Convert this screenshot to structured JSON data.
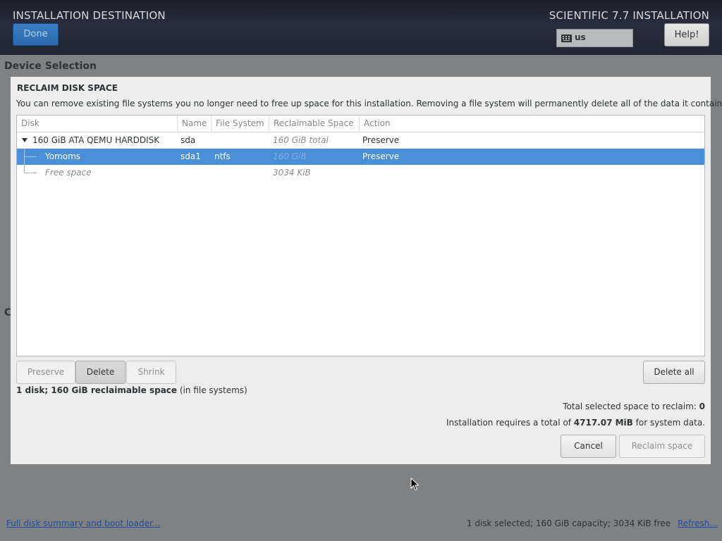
{
  "header": {
    "title": "INSTALLATION DESTINATION",
    "product": "SCIENTIFIC 7.7 INSTALLATION",
    "done_label": "Done",
    "keyboard_layout": "us",
    "help_label": "Help!"
  },
  "page": {
    "device_selection": "Device Selection",
    "partial_letter": "C",
    "full_disk_link": "Full disk summary and boot loader...",
    "status": "1 disk selected; 160 GiB capacity; 3034 KiB free",
    "refresh_link": "Refresh..."
  },
  "dialog": {
    "title": "RECLAIM DISK SPACE",
    "description": "You can remove existing file systems you no longer need to free up space for this installation.  Removing a file system will permanently delete all of the data it contains.",
    "columns": [
      "Disk",
      "Name",
      "File System",
      "Reclaimable Space",
      "Action"
    ],
    "rows": [
      {
        "disk": "160 GiB ATA QEMU HARDDISK",
        "name": "sda",
        "filesystem": "",
        "reclaimable": "160 GiB total",
        "action": "Preserve"
      },
      {
        "disk": "Yomoms",
        "name": "sda1",
        "filesystem": "ntfs",
        "reclaimable": "160 GiB",
        "action": "Preserve"
      },
      {
        "disk": "Free space",
        "name": "",
        "filesystem": "",
        "reclaimable": "3034 KiB",
        "action": ""
      }
    ],
    "buttons": {
      "preserve": "Preserve",
      "delete": "Delete",
      "shrink": "Shrink",
      "delete_all": "Delete all",
      "cancel": "Cancel",
      "reclaim": "Reclaim space"
    },
    "summary": {
      "disk_count": "1 disk; 160 GiB reclaimable space",
      "suffix": "(in file systems)"
    },
    "total_selected": {
      "label": "Total selected space to reclaim:",
      "value": "0"
    },
    "requirement": {
      "prefix": "Installation requires a total of",
      "value": "4717.07 MiB",
      "suffix": "for system data."
    }
  },
  "colors": {
    "selection": "#4a90d9",
    "header_bg": "#222633",
    "done_button": "#2a6aad"
  }
}
